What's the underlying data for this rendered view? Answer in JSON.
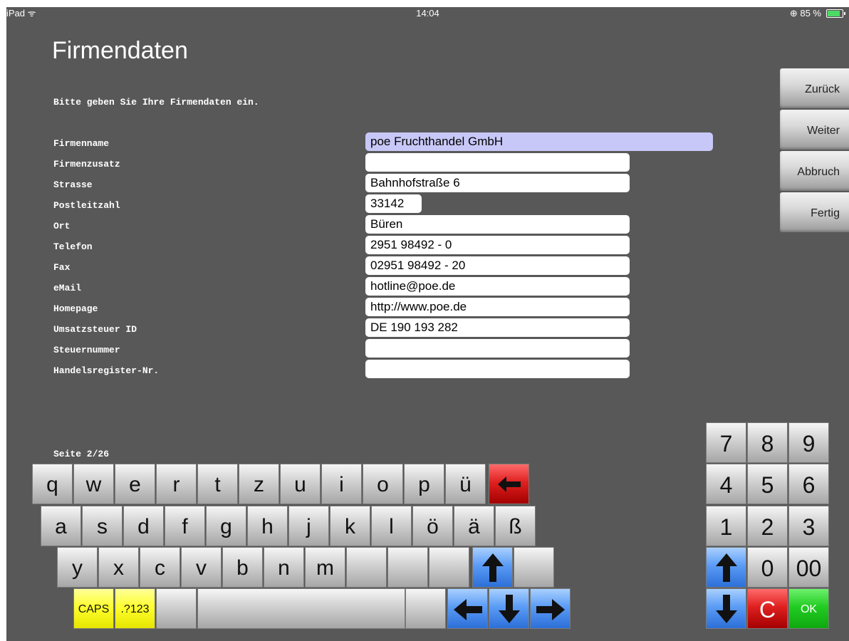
{
  "status_bar": {
    "left": "iPad ᯤ",
    "time": "14:04",
    "battery": "⊕ 85 %"
  },
  "title": "Firmendaten",
  "instruction": "Bitte geben Sie Ihre Firmendaten ein.",
  "fields": [
    {
      "label": "Firmenname",
      "value": "poe Fruchthandel GmbH"
    },
    {
      "label": "Firmenzusatz",
      "value": ""
    },
    {
      "label": "Strasse",
      "value": "Bahnhofstraße 6"
    },
    {
      "label": "Postleitzahl",
      "value": "33142"
    },
    {
      "label": "Ort",
      "value": "Büren"
    },
    {
      "label": "Telefon",
      "value": "2951 98492 - 0"
    },
    {
      "label": "Fax",
      "value": "02951 98492 - 20"
    },
    {
      "label": "eMail",
      "value": "hotline@poe.de"
    },
    {
      "label": "Homepage",
      "value": "http://www.poe.de"
    },
    {
      "label": "Umsatzsteuer ID",
      "value": "DE 190 193 282"
    },
    {
      "label": "Steuernummer",
      "value": ""
    },
    {
      "label": "Handelsregister-Nr.",
      "value": ""
    }
  ],
  "nav": {
    "back": "Zurück",
    "next": "Weiter",
    "cancel": "Abbruch",
    "done": "Fertig"
  },
  "page_indicator": "Seite 2/26",
  "keyboard": {
    "row1": [
      "q",
      "w",
      "e",
      "r",
      "t",
      "z",
      "u",
      "i",
      "o",
      "p",
      "ü"
    ],
    "row2": [
      "a",
      "s",
      "d",
      "f",
      "g",
      "h",
      "j",
      "k",
      "l",
      "ö",
      "ä",
      "ß"
    ],
    "row3": [
      "y",
      "x",
      "c",
      "v",
      "b",
      "n",
      "m"
    ],
    "caps": "CAPS",
    "symbols": ".?123",
    "backspace_icon": "backspace-arrow-left-icon",
    "shift_icon": "arrow-up-icon"
  },
  "numpad": {
    "rows": [
      [
        "7",
        "8",
        "9"
      ],
      [
        "4",
        "5",
        "6"
      ],
      [
        "1",
        "2",
        "3"
      ]
    ],
    "zero": "0",
    "double_zero": "00",
    "clear": "C",
    "ok": "OK"
  },
  "colors": {
    "background": "#585858",
    "active_field": "#c8c8f8",
    "red_key": "#e02020",
    "blue_key": "#5b9cf5",
    "yellow_key": "#ffff30",
    "green_key": "#22cc22"
  }
}
